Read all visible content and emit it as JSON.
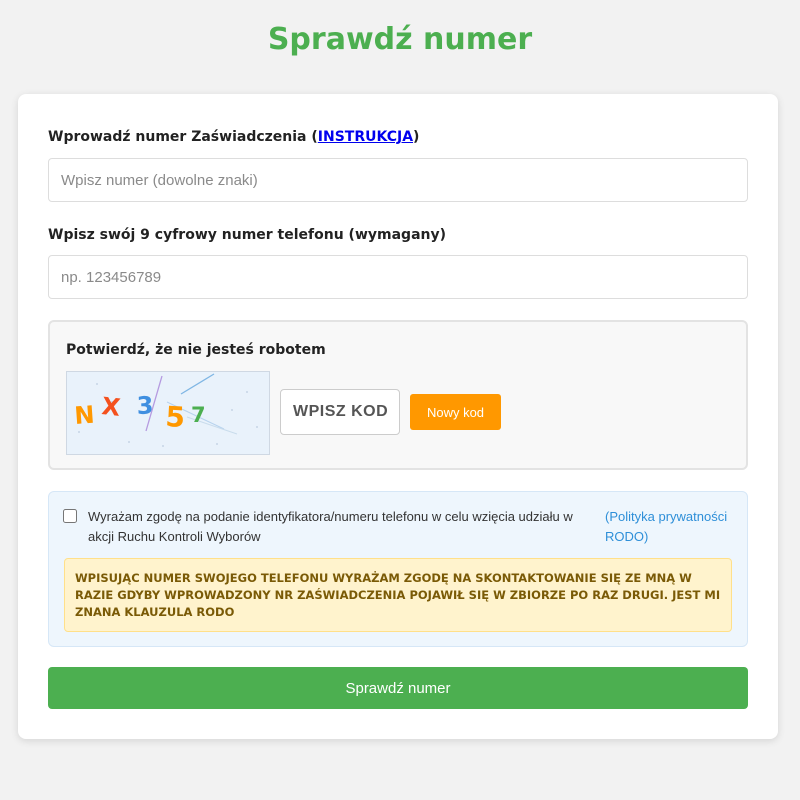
{
  "page": {
    "title": "Sprawdź numer"
  },
  "certificate": {
    "label_prefix": "Wprowadź numer Zaświadczenia (",
    "instruction_link": "INSTRUKCJA",
    "label_suffix": ")",
    "placeholder": "Wpisz numer (dowolne znaki)",
    "value": ""
  },
  "phone": {
    "label": "Wpisz swój 9 cyfrowy numer telefonu (wymagany)",
    "placeholder": "np. 123456789",
    "value": ""
  },
  "captcha": {
    "title": "Potwierdź, że nie jesteś robotem",
    "characters": [
      {
        "char": "N",
        "color": "#ff9800"
      },
      {
        "char": "X",
        "color": "#f4511e"
      },
      {
        "char": "3",
        "color": "#3f8fe0"
      },
      {
        "char": "5",
        "color": "#ff9800"
      },
      {
        "char": "7",
        "color": "#4caf50"
      }
    ],
    "input_placeholder": "WPISZ KOD",
    "new_code_label": "Nowy kod"
  },
  "consent": {
    "checked": false,
    "text": "Wyrażam zgodę na podanie identyfikatora/numeru telefonu w celu wzięcia udziału w akcji Ruchu Kontroli Wyborów",
    "policy_link": "(Polityka prywatności RODO)",
    "warning": "WPISUJĄC NUMER SWOJEGO TELEFONU WYRAŻAM ZGODĘ NA SKONTAKTOWANIE SIĘ ZE MNĄ W RAZIE GDYBY WPROWADZONY NR ZAŚWIADCZENIA POJAWIŁ SIĘ W ZBIORZE PO RAZ DRUGI. JEST MI ZNANA KLAUZULA RODO"
  },
  "submit": {
    "label": "Sprawdź numer"
  },
  "colors": {
    "accent_green": "#4caf50",
    "orange": "#ff9800",
    "link_blue": "#2e8fd8",
    "warning_bg": "#fff3cd",
    "consent_bg": "#eef6fd"
  }
}
